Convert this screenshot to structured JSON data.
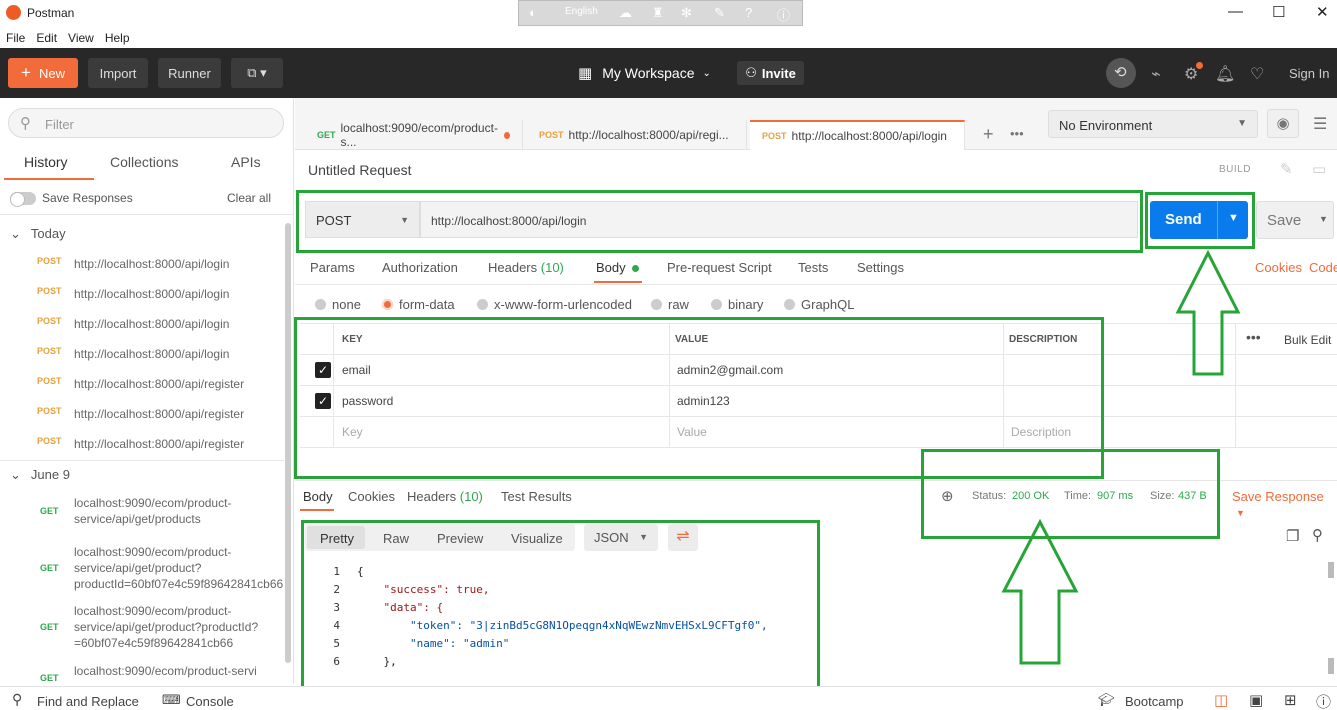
{
  "window": {
    "title": "Postman",
    "controls": [
      "—",
      "☐",
      "✕"
    ]
  },
  "ime_bar": {
    "language": "English"
  },
  "menu": [
    "File",
    "Edit",
    "View",
    "Help"
  ],
  "toolbar": {
    "new_label": "New",
    "import_label": "Import",
    "runner_label": "Runner",
    "workspace_label": "My Workspace",
    "invite_label": "Invite",
    "signin_label": "Sign In"
  },
  "sidebar": {
    "filter_placeholder": "Filter",
    "tabs": [
      "History",
      "Collections",
      "APIs"
    ],
    "save_responses_label": "Save Responses",
    "clear_all_label": "Clear all",
    "groups": [
      {
        "label": "Today",
        "items": [
          {
            "method": "POST",
            "url": "http://localhost:8000/api/login"
          },
          {
            "method": "POST",
            "url": "http://localhost:8000/api/login"
          },
          {
            "method": "POST",
            "url": "http://localhost:8000/api/login"
          },
          {
            "method": "POST",
            "url": "http://localhost:8000/api/login"
          },
          {
            "method": "POST",
            "url": "http://localhost:8000/api/register"
          },
          {
            "method": "POST",
            "url": "http://localhost:8000/api/register"
          },
          {
            "method": "POST",
            "url": "http://localhost:8000/api/register"
          }
        ]
      },
      {
        "label": "June 9",
        "items": [
          {
            "method": "GET",
            "url": "localhost:9090/ecom/product-service/api/get/products"
          },
          {
            "method": "GET",
            "url": "localhost:9090/ecom/product-service/api/get/product?productId=60bf07e4c59f89642841cb66"
          },
          {
            "method": "GET",
            "url": "localhost:9090/ecom/product-service/api/get/product?productId?=60bf07e4c59f89642841cb66"
          },
          {
            "method": "GET",
            "url": "localhost:9090/ecom/product-servi"
          }
        ]
      }
    ]
  },
  "request_tabs": [
    {
      "method": "GET",
      "label": "localhost:9090/ecom/product-s..."
    },
    {
      "method": "POST",
      "label": "http://localhost:8000/api/regi..."
    },
    {
      "method": "POST",
      "label": "http://localhost:8000/api/login"
    }
  ],
  "environment": {
    "selected": "No Environment"
  },
  "request": {
    "title": "Untitled Request",
    "build_label": "BUILD",
    "method": "POST",
    "url": "http://localhost:8000/api/login",
    "send_label": "Send",
    "save_label": "Save",
    "tabs": [
      {
        "label": "Params"
      },
      {
        "label": "Authorization"
      },
      {
        "label": "Headers",
        "count": "(10)"
      },
      {
        "label": "Body"
      },
      {
        "label": "Pre-request Script"
      },
      {
        "label": "Tests"
      },
      {
        "label": "Settings"
      }
    ],
    "cookies_label": "Cookies",
    "code_label": "Code",
    "body_types": [
      "none",
      "form-data",
      "x-www-form-urlencoded",
      "raw",
      "binary",
      "GraphQL"
    ],
    "body_type_selected": "form-data",
    "params_table": {
      "headers": [
        "KEY",
        "VALUE",
        "DESCRIPTION"
      ],
      "bulk_edit_label": "Bulk Edit",
      "rows": [
        {
          "checked": true,
          "key": "email",
          "value": "admin2@gmail.com",
          "description": ""
        },
        {
          "checked": true,
          "key": "password",
          "value": "admin123",
          "description": ""
        }
      ],
      "placeholder": {
        "key": "Key",
        "value": "Value",
        "description": "Description"
      }
    }
  },
  "response": {
    "tabs": [
      {
        "label": "Body"
      },
      {
        "label": "Cookies"
      },
      {
        "label": "Headers",
        "count": "(10)"
      },
      {
        "label": "Test Results"
      }
    ],
    "status_label": "Status:",
    "status_value": "200 OK",
    "time_label": "Time:",
    "time_value": "907 ms",
    "size_label": "Size:",
    "size_value": "437 B",
    "save_response_label": "Save Response",
    "view_tabs": [
      "Pretty",
      "Raw",
      "Preview",
      "Visualize"
    ],
    "format": "JSON",
    "code_lines": [
      {
        "n": "1",
        "text": "{"
      },
      {
        "n": "2",
        "text": "    \"success\": true,"
      },
      {
        "n": "3",
        "text": "    \"data\": {"
      },
      {
        "n": "4",
        "text": "        \"token\": \"3|zinBd5cG8N1Opeqgn4xNqWEwzNmvEHSxL9CFTgf0\","
      },
      {
        "n": "5",
        "text": "        \"name\": \"admin\""
      },
      {
        "n": "6",
        "text": "    },"
      }
    ]
  },
  "statusbar": {
    "find_replace_label": "Find and Replace",
    "console_label": "Console",
    "bootcamp_label": "Bootcamp"
  },
  "colors": {
    "accent": "#f26b3a",
    "send": "#097bed",
    "annotation": "#26a437",
    "success": "#2fa84f"
  }
}
